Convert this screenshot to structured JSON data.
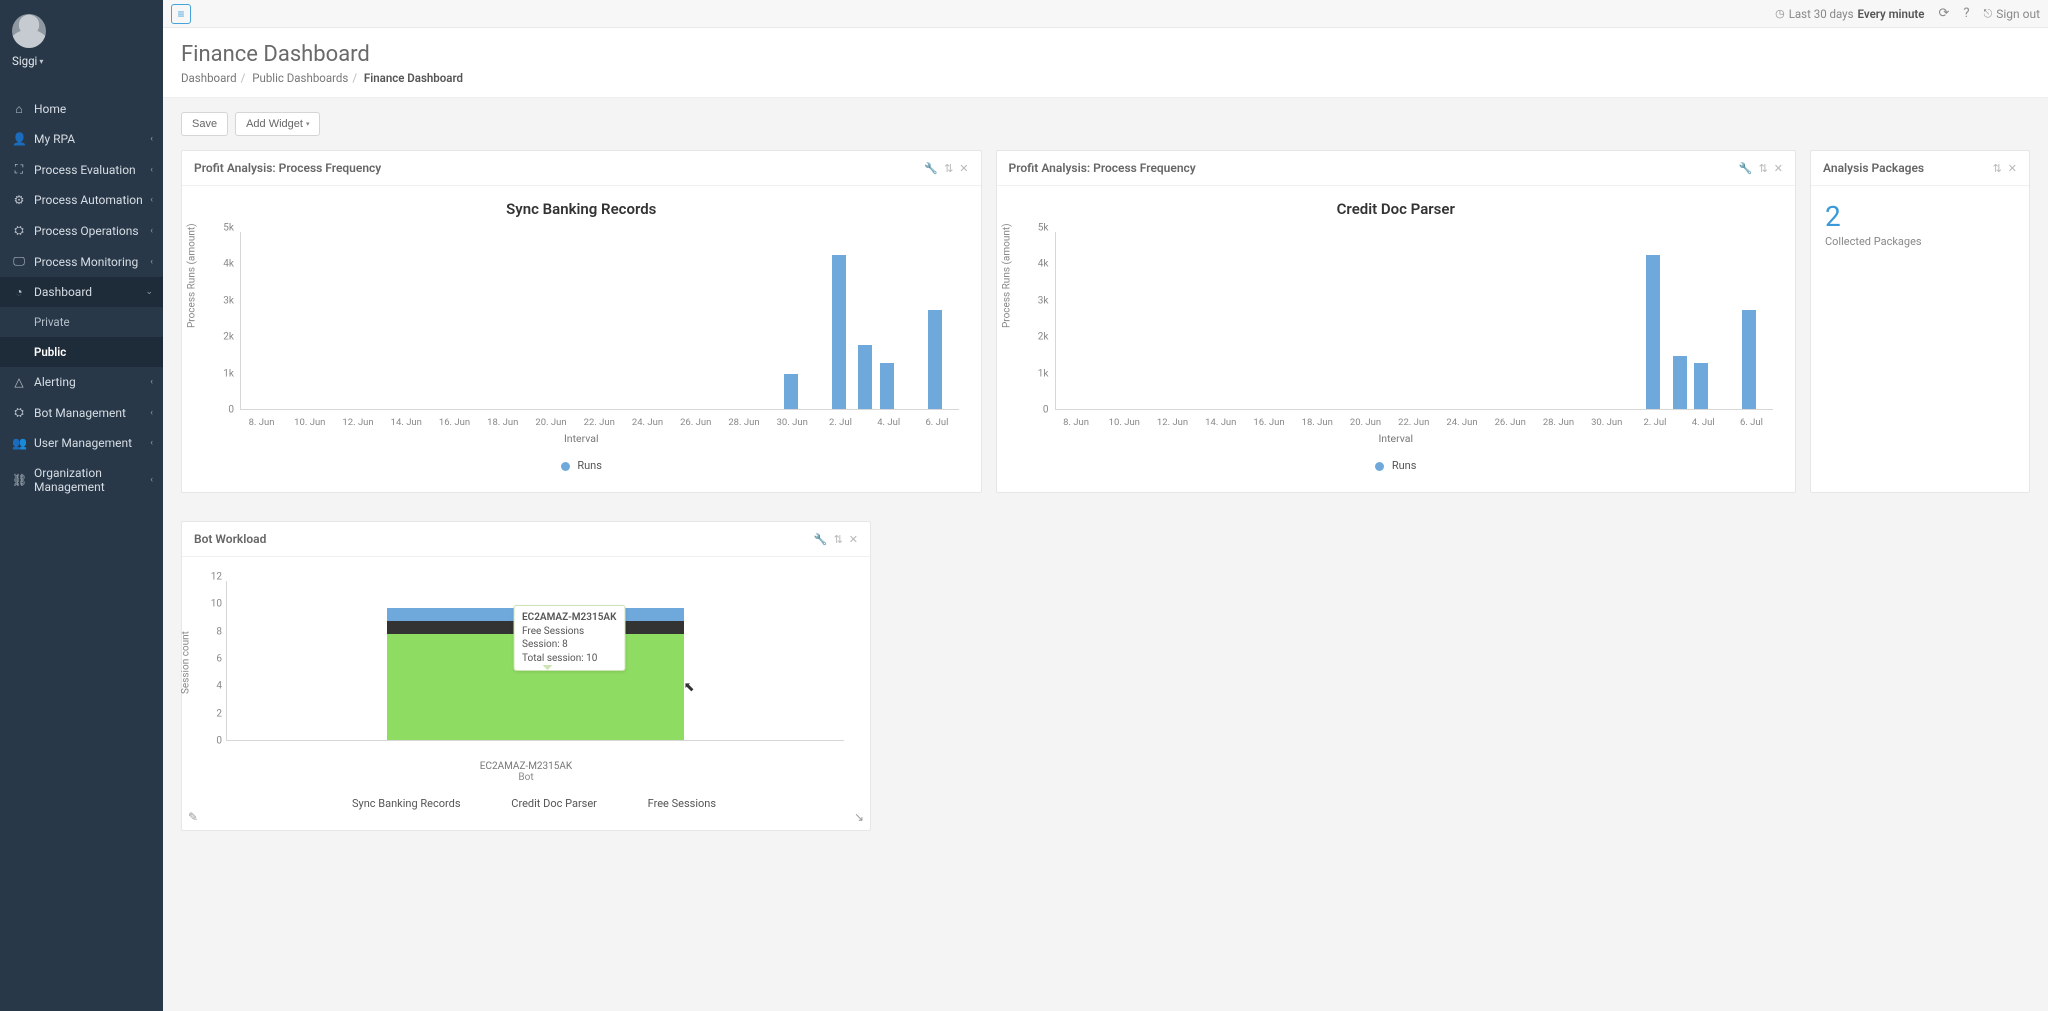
{
  "user": {
    "name": "Siggi"
  },
  "nav": [
    {
      "label": "Home",
      "icon": "⌂"
    },
    {
      "label": "My RPA",
      "icon": "👤",
      "chev": true
    },
    {
      "label": "Process Evaluation",
      "icon": "⛶",
      "chev": true
    },
    {
      "label": "Process Automation",
      "icon": "⚙",
      "chev": true
    },
    {
      "label": "Process Operations",
      "icon": "⛭",
      "chev": true
    },
    {
      "label": "Process Monitoring",
      "icon": "🖵",
      "chev": true
    },
    {
      "label": "Dashboard",
      "icon": "◔",
      "chev": true,
      "open": true,
      "children": [
        {
          "label": "Private"
        },
        {
          "label": "Public",
          "active": true
        }
      ]
    },
    {
      "label": "Alerting",
      "icon": "△",
      "chev": true
    },
    {
      "label": "Bot Management",
      "icon": "⛭",
      "chev": true
    },
    {
      "label": "User Management",
      "icon": "👥",
      "chev": true
    },
    {
      "label": "Organization Management",
      "icon": "⛓",
      "chev": true
    }
  ],
  "topbar": {
    "range_prefix": "Last 30 days",
    "range_bold": "Every minute",
    "signout": "Sign out"
  },
  "page": {
    "title": "Finance Dashboard",
    "crumbs": [
      "Dashboard",
      "Public Dashboards",
      "Finance Dashboard"
    ]
  },
  "actions": {
    "save": "Save",
    "add": "Add Widget"
  },
  "chart_data": [
    {
      "widget_title": "Profit Analysis: Process Frequency",
      "type": "bar",
      "title": "Sync Banking Records",
      "ylabel": "Process Runs (amount)",
      "xlabel": "Interval",
      "ylim": [
        0,
        5000
      ],
      "yticks": [
        0,
        "1k",
        "2k",
        "3k",
        "4k",
        "5k"
      ],
      "categories": [
        "8. Jun",
        "10. Jun",
        "12. Jun",
        "14. Jun",
        "16. Jun",
        "18. Jun",
        "20. Jun",
        "22. Jun",
        "24. Jun",
        "26. Jun",
        "28. Jun",
        "30. Jun",
        "2. Jul",
        "4. Jul",
        "6. Jul"
      ],
      "series": [
        {
          "name": "Runs",
          "color": "#6fa9dc",
          "values": [
            0,
            0,
            0,
            0,
            0,
            0,
            0,
            0,
            0,
            0,
            0,
            1000,
            4350,
            1800,
            1300,
            2800
          ]
        }
      ],
      "bar_offsets_pct": [
        3.3,
        10,
        16.7,
        23.3,
        30,
        36.7,
        43.3,
        50,
        56.7,
        63.3,
        70,
        76.7,
        83.3,
        87,
        90,
        96.7
      ]
    },
    {
      "widget_title": "Profit Analysis: Process Frequency",
      "type": "bar",
      "title": "Credit Doc Parser",
      "ylabel": "Process Runs (amount)",
      "xlabel": "Interval",
      "ylim": [
        0,
        5000
      ],
      "yticks": [
        0,
        "1k",
        "2k",
        "3k",
        "4k",
        "5k"
      ],
      "categories": [
        "8. Jun",
        "10. Jun",
        "12. Jun",
        "14. Jun",
        "16. Jun",
        "18. Jun",
        "20. Jun",
        "22. Jun",
        "24. Jun",
        "26. Jun",
        "28. Jun",
        "30. Jun",
        "2. Jul",
        "4. Jul",
        "6. Jul"
      ],
      "series": [
        {
          "name": "Runs",
          "color": "#6fa9dc",
          "values": [
            0,
            0,
            0,
            0,
            0,
            0,
            0,
            0,
            0,
            0,
            0,
            0,
            4350,
            1500,
            1300,
            2800
          ]
        }
      ],
      "bar_offsets_pct": [
        3.3,
        10,
        16.7,
        23.3,
        30,
        36.7,
        43.3,
        50,
        56.7,
        63.3,
        70,
        76.7,
        83.3,
        87,
        90,
        96.7
      ]
    },
    {
      "widget_title": "Bot Workload",
      "type": "stacked-bar",
      "ylabel": "Session count",
      "xlabel": "Bot",
      "ylim": [
        0,
        12
      ],
      "yticks": [
        0,
        2,
        4,
        6,
        8,
        10,
        12
      ],
      "categories": [
        "EC2AMAZ-M2315AK"
      ],
      "series": [
        {
          "name": "Sync Banking Records",
          "color": "#6fa9dc",
          "values": [
            1
          ]
        },
        {
          "name": "Credit Doc Parser",
          "color": "#333333",
          "values": [
            1
          ]
        },
        {
          "name": "Free Sessions",
          "color": "#8fdc63",
          "values": [
            8
          ]
        }
      ],
      "tooltip": {
        "title": "EC2AMAZ-M2315AK",
        "lines": [
          "Free Sessions",
          "Session: 8",
          "Total session: 10"
        ]
      }
    }
  ],
  "packages": {
    "title": "Analysis Packages",
    "value": "2",
    "label": "Collected Packages"
  }
}
